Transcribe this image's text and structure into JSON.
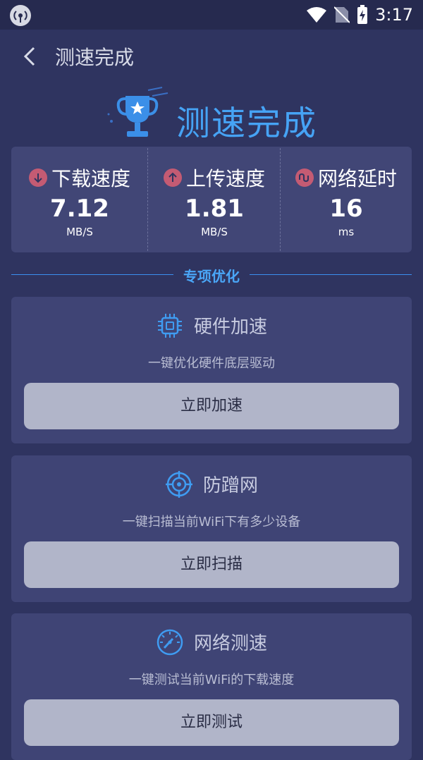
{
  "status_bar": {
    "time": "3:17"
  },
  "header": {
    "title": "测速完成"
  },
  "hero": {
    "title": "测速完成"
  },
  "stats": [
    {
      "label": "下载速度",
      "value": "7.12",
      "unit": "MB/S",
      "icon": "arrow-down-icon"
    },
    {
      "label": "上传速度",
      "value": "1.81",
      "unit": "MB/S",
      "icon": "arrow-up-icon"
    },
    {
      "label": "网络延时",
      "value": "16",
      "unit": "ms",
      "icon": "wave-icon"
    }
  ],
  "section": {
    "title": "专项优化"
  },
  "cards": [
    {
      "title": "硬件加速",
      "desc": "一键优化硬件底层驱动",
      "button": "立即加速",
      "icon": "chip-icon"
    },
    {
      "title": "防蹭网",
      "desc": "一键扫描当前WiFi下有多少设备",
      "button": "立即扫描",
      "icon": "target-icon"
    },
    {
      "title": "网络测速",
      "desc": "一键测试当前WiFi的下载速度",
      "button": "立即测试",
      "icon": "speedometer-icon"
    }
  ],
  "colors": {
    "accent": "#46a3f5",
    "background": "#2f3460",
    "card": "#3f4475",
    "stat_icon": "#c45b73"
  }
}
